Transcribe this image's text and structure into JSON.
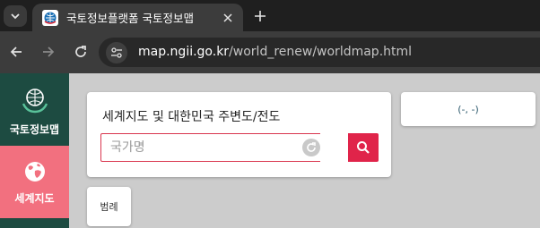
{
  "browser": {
    "tab_title": "국토정보플랫폼 국토정보맵",
    "url_host": "map.ngii.go.kr",
    "url_path": "/world_renew/worldmap.html"
  },
  "sidebar": {
    "items": [
      {
        "label": "국토정보맵",
        "icon": "globe-hands-icon"
      },
      {
        "label": "세계지도",
        "icon": "earth-icon",
        "active": true
      }
    ]
  },
  "search": {
    "title": "세계지도 및 대한민국 주변도/전도",
    "placeholder": "국가명",
    "value": ""
  },
  "coordinates": {
    "text": "(-, -)"
  },
  "legend": {
    "label": "범례"
  },
  "colors": {
    "sidebar_bg": "#1d4b41",
    "active_item": "#f2707f",
    "accent": "#e0244a",
    "map_bg": "#cccccc"
  }
}
